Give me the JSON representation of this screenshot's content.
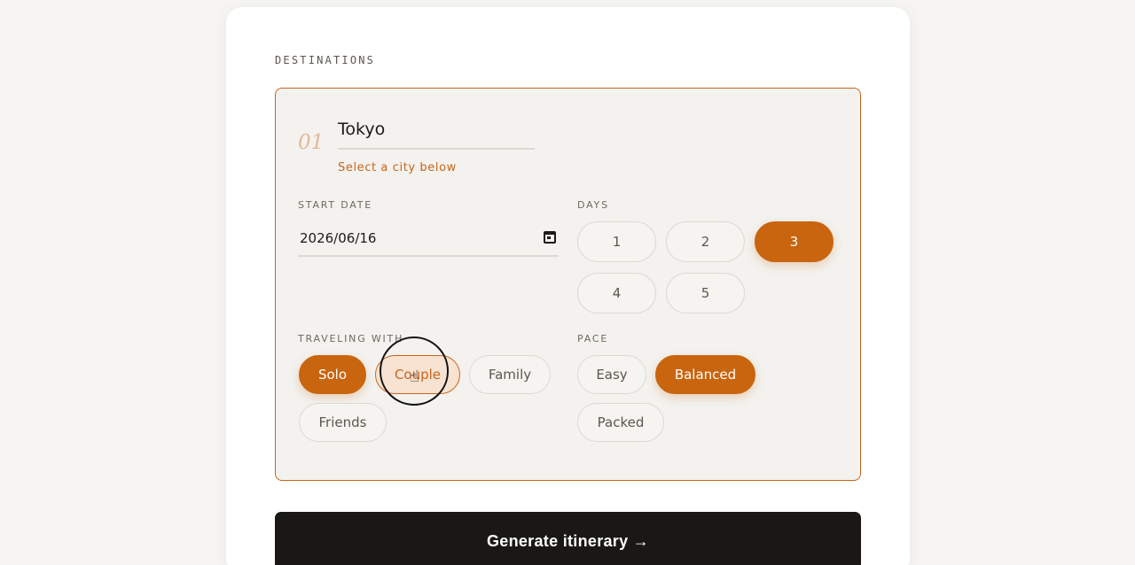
{
  "section": {
    "title": "DESTINATIONS"
  },
  "destination": {
    "number": "01",
    "city_value": "Tokyo",
    "city_hint": "Select a city below",
    "start_date_label": "START DATE",
    "start_date_value": "2026/06/16",
    "days_label": "DAYS",
    "days": [
      {
        "label": "1",
        "selected": false
      },
      {
        "label": "2",
        "selected": false
      },
      {
        "label": "3",
        "selected": true
      },
      {
        "label": "4",
        "selected": false
      },
      {
        "label": "5",
        "selected": false
      }
    ],
    "traveling_label": "TRAVELING WITH",
    "traveling": [
      {
        "label": "Solo",
        "selected": true
      },
      {
        "label": "Couple",
        "selected": false,
        "hovered": true
      },
      {
        "label": "Family",
        "selected": false
      },
      {
        "label": "Friends",
        "selected": false
      }
    ],
    "pace_label": "PACE",
    "pace": [
      {
        "label": "Easy",
        "selected": false
      },
      {
        "label": "Balanced",
        "selected": true
      },
      {
        "label": "Packed",
        "selected": false
      }
    ]
  },
  "actions": {
    "generate_label": "Generate itinerary →"
  },
  "colors": {
    "accent": "#c9650f",
    "card_bg": "#f3f2ee",
    "button_dark": "#1a1815"
  },
  "icons": {
    "calendar": "calendar-icon",
    "cursor": "pointer-hand-icon"
  }
}
